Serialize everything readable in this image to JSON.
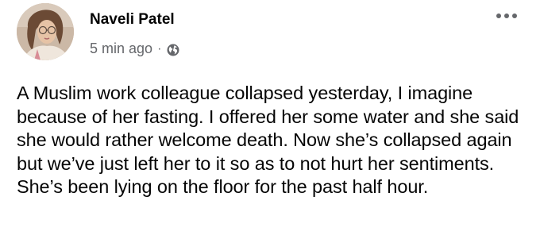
{
  "post": {
    "author_name": "Naveli Patel",
    "timestamp": "5 min ago",
    "separator": "·",
    "privacy_icon": "globe-icon",
    "more_icon": "more-options-icon",
    "body": "A Muslim work colleague collapsed yesterday, I imagine because of her fasting. I offered her some water and she said she would rather welcome death. Now she’s collapsed again but we’ve just left her to it so as to not hurt her sentiments. She’s been lying on the floor for the past half hour."
  },
  "colors": {
    "name_text": "#050505",
    "meta_text": "#65676b",
    "background": "#ffffff"
  }
}
